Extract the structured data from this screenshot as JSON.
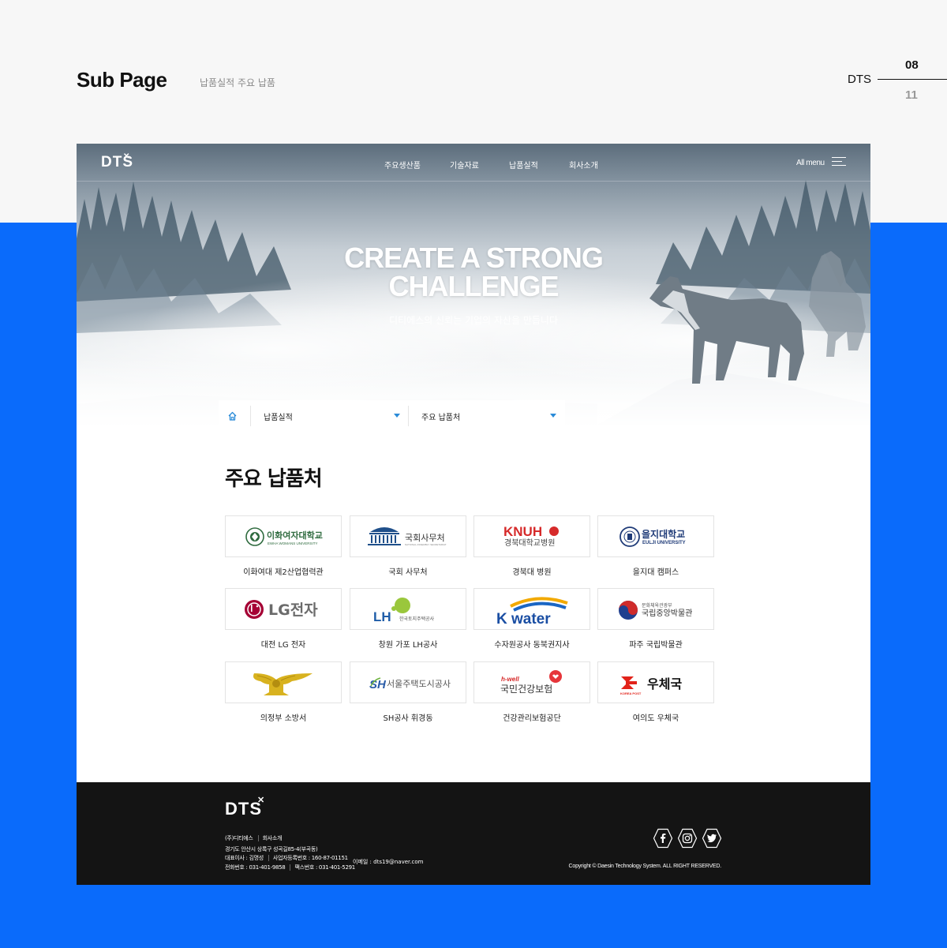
{
  "presentation": {
    "title": "Sub Page",
    "subtitle": "납품실적 주요 납품",
    "brand": "DTS",
    "page_current": "08",
    "page_total": "11"
  },
  "site": {
    "logo": "DTS",
    "logo_mark": "✕",
    "nav": [
      "주요생산품",
      "기술자료",
      "납품실적",
      "회사소개"
    ],
    "all_menu": "All menu",
    "hero_title_line1": "CREATE A STRONG",
    "hero_title_line2": "CHALLENGE",
    "hero_subtitle": "디티에스의 신뢰는 기업의 자산을 만듭니다",
    "breadcrumb": {
      "level1": "납품실적",
      "level2": "주요 납품처"
    },
    "section_title": "주요 납품처",
    "clients": [
      {
        "logo_text": "이화여자대학교",
        "logo_sub": "EWHA WOMANS UNIVERSITY",
        "label": "이화여대 제2산업협력관"
      },
      {
        "logo_text": "국회사무처",
        "logo_sub": "NATIONAL ASSEMBLY SECRETARIAT",
        "label": "국회 사무처"
      },
      {
        "logo_text": "KNUH",
        "logo_sub": "경북대학교병원",
        "label": "경북대 병원"
      },
      {
        "logo_text": "을지대학교",
        "logo_sub": "EULJI UNIVERSITY",
        "label": "을지대 캠퍼스"
      },
      {
        "logo_text": "LG전자",
        "logo_sub": "",
        "label": "대전 LG 전자"
      },
      {
        "logo_text": "LH",
        "logo_sub": "한국토지주택공사",
        "label": "창원 가포 LH공사"
      },
      {
        "logo_text": "K water",
        "logo_sub": "",
        "label": "수자원공사 동북권지사"
      },
      {
        "logo_text": "국립중앙박물관",
        "logo_sub": "문화체육관광부",
        "label": "파주 국립박물관"
      },
      {
        "logo_text": "",
        "logo_sub": "",
        "label": "의정부 소방서"
      },
      {
        "logo_text": "서울주택도시공사",
        "logo_sub": "SH",
        "label": "SH공사 휘경동"
      },
      {
        "logo_text": "국민건강보험",
        "logo_sub": "h-well",
        "label": "건강관리보험공단"
      },
      {
        "logo_text": "우체국",
        "logo_sub": "KOREA POST",
        "label": "여의도 우체국"
      }
    ],
    "footer": {
      "logo": "DTS",
      "logo_mark": "✕",
      "links": [
        "(주)디티에스",
        "회사소개"
      ],
      "address": "경기도 안산시 상록구 성곡길85-4(부곡동)",
      "ceo": "대표이사 : 김명성",
      "biz_no": "사업자등록번호 : 160-87-01151",
      "phone": "전화번호 : 031-401-9858",
      "fax": "팩스번호 : 031-401-5291",
      "email": "이메일 : dts19@naver.com",
      "copyright": "Copyright © Daesin Technology System. ALL RIGHT RESERVED."
    }
  },
  "colors": {
    "accent_blue": "#0a6bfb",
    "footer_bg": "#141414",
    "breadcrumb_arrow": "#2a8bd8"
  }
}
